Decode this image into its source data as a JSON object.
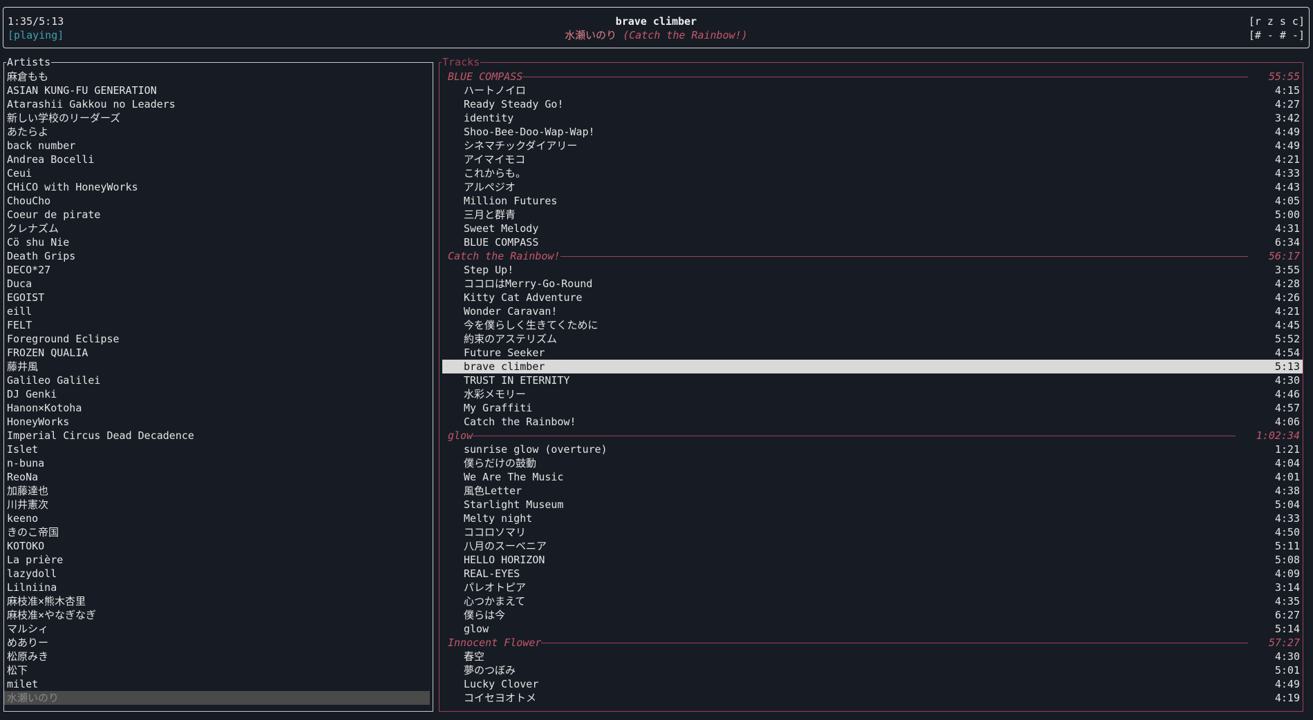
{
  "header": {
    "position": "1:35/5:13",
    "state": "[playing]",
    "title": "brave climber",
    "artist": "水瀬いのり",
    "album": "(Catch the Rainbow!)",
    "flags_line1": "[r z s c]",
    "flags_line2": "[# - # -]"
  },
  "artists": {
    "title": "Artists",
    "selected": "水瀬いのり",
    "items": [
      "麻倉もも",
      "ASIAN KUNG-FU GENERATION",
      "Atarashii Gakkou no Leaders",
      "新しい学校のリーダーズ",
      "あたらよ",
      "back number",
      "Andrea Bocelli",
      "Ceui",
      "CHiCO with HoneyWorks",
      "ChouCho",
      "Coeur de pirate",
      "クレナズム",
      "Cö shu Nie",
      "Death Grips",
      "DECO*27",
      "Duca",
      "EGOIST",
      "eill",
      "FELT",
      "Foreground Eclipse",
      "FROZEN QUALIA",
      "藤井風",
      "Galileo Galilei",
      "DJ Genki",
      "Hanon×Kotoha",
      "HoneyWorks",
      "Imperial Circus Dead Decadence",
      "Islet",
      "n-buna",
      "ReoNa",
      "加藤達也",
      "川井憲次",
      "keeno",
      "きのこ帝国",
      "KOTOKO",
      "La prière",
      "lazydoll",
      "Lilniina",
      "麻枝准×熊木杏里",
      "麻枝准×やなぎなぎ",
      "マルシィ",
      "めありー",
      "松原みき",
      "松下",
      "milet",
      "水瀬いのり"
    ]
  },
  "tracks": {
    "title": "Tracks",
    "current": "brave climber",
    "albums": [
      {
        "name": "BLUE COMPASS",
        "duration": "55:55",
        "tracks": [
          {
            "title": "ハートノイロ",
            "duration": "4:15"
          },
          {
            "title": "Ready Steady Go!",
            "duration": "4:27"
          },
          {
            "title": "identity",
            "duration": "3:42"
          },
          {
            "title": "Shoo-Bee-Doo-Wap-Wap!",
            "duration": "4:49"
          },
          {
            "title": "シネマチックダイアリー",
            "duration": "4:49"
          },
          {
            "title": "アイマイモコ",
            "duration": "4:21"
          },
          {
            "title": "これからも。",
            "duration": "4:33"
          },
          {
            "title": "アルペジオ",
            "duration": "4:43"
          },
          {
            "title": "Million Futures",
            "duration": "4:05"
          },
          {
            "title": "三月と群青",
            "duration": "5:00"
          },
          {
            "title": "Sweet Melody",
            "duration": "4:31"
          },
          {
            "title": "BLUE COMPASS",
            "duration": "6:34"
          }
        ]
      },
      {
        "name": "Catch the Rainbow!",
        "duration": "56:17",
        "tracks": [
          {
            "title": "Step Up!",
            "duration": "3:55"
          },
          {
            "title": "ココロはMerry-Go-Round",
            "duration": "4:28"
          },
          {
            "title": "Kitty Cat Adventure",
            "duration": "4:26"
          },
          {
            "title": "Wonder Caravan!",
            "duration": "4:21"
          },
          {
            "title": "今を僕らしく生きてくために",
            "duration": "4:45"
          },
          {
            "title": "約束のアステリズム",
            "duration": "5:52"
          },
          {
            "title": "Future Seeker",
            "duration": "4:54"
          },
          {
            "title": "brave climber",
            "duration": "5:13"
          },
          {
            "title": "TRUST IN ETERNITY",
            "duration": "4:30"
          },
          {
            "title": "水彩メモリー",
            "duration": "4:46"
          },
          {
            "title": "My Graffiti",
            "duration": "4:57"
          },
          {
            "title": "Catch the Rainbow!",
            "duration": "4:06"
          }
        ]
      },
      {
        "name": "glow",
        "duration": "1:02:34",
        "tracks": [
          {
            "title": "sunrise glow (overture)",
            "duration": "1:21"
          },
          {
            "title": "僕らだけの鼓動",
            "duration": "4:04"
          },
          {
            "title": "We Are The Music",
            "duration": "4:01"
          },
          {
            "title": "風色Letter",
            "duration": "4:38"
          },
          {
            "title": "Starlight Museum",
            "duration": "5:04"
          },
          {
            "title": "Melty night",
            "duration": "4:33"
          },
          {
            "title": "ココロソマリ",
            "duration": "4:50"
          },
          {
            "title": "八月のスーベニア",
            "duration": "5:11"
          },
          {
            "title": "HELLO HORIZON",
            "duration": "5:08"
          },
          {
            "title": "REAL-EYES",
            "duration": "4:09"
          },
          {
            "title": "パレオトピア",
            "duration": "3:14"
          },
          {
            "title": "心つかまえて",
            "duration": "4:35"
          },
          {
            "title": "僕らは今",
            "duration": "6:27"
          },
          {
            "title": "glow",
            "duration": "5:14"
          }
        ]
      },
      {
        "name": "Innocent Flower",
        "duration": "57:27",
        "tracks": [
          {
            "title": "春空",
            "duration": "4:30"
          },
          {
            "title": "夢のつぼみ",
            "duration": "5:01"
          },
          {
            "title": "Lucky Clover",
            "duration": "4:49"
          },
          {
            "title": "コイセヨオトメ",
            "duration": "4:19"
          }
        ]
      }
    ]
  }
}
